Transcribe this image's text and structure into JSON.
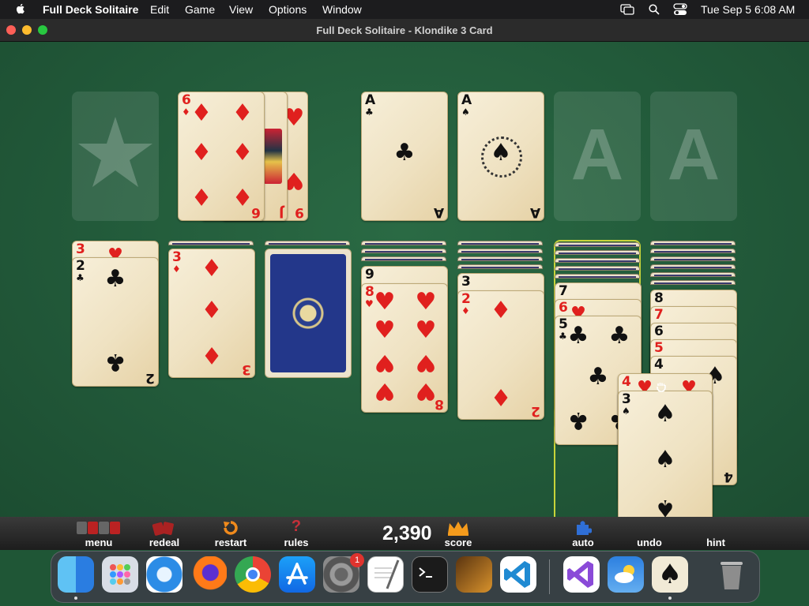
{
  "menubar": {
    "app_name": "Full Deck Solitaire",
    "menus": [
      "Edit",
      "Game",
      "View",
      "Options",
      "Window"
    ],
    "datetime": "Tue Sep 5  6:08 AM"
  },
  "window": {
    "title": "Full Deck Solitaire - Klondike 3 Card"
  },
  "foundation_placeholder_letter": "A",
  "suit_glyphs": {
    "clubs": "♣",
    "spades": "♠",
    "hearts": "♥",
    "diamonds": "♦"
  },
  "cards": {
    "waste_top": {
      "rank": "6",
      "suit": "diamonds"
    },
    "waste_mid": {
      "rank": "J"
    },
    "waste_under": {
      "rank": "9",
      "suit": "hearts"
    },
    "foundation_1": {
      "rank": "A",
      "suit": "clubs"
    },
    "foundation_2": {
      "rank": "A",
      "suit": "spades"
    },
    "t1_under": {
      "rank": "3",
      "suit": "hearts"
    },
    "t1_top": {
      "rank": "2",
      "suit": "clubs"
    },
    "t2_top": {
      "rank": "3",
      "suit": "diamonds"
    },
    "t4_under": {
      "rank": "9",
      "suit": "spades"
    },
    "t4_top": {
      "rank": "8",
      "suit": "hearts"
    },
    "t5_under": {
      "rank": "3",
      "suit": "spades"
    },
    "t5_top": {
      "rank": "2",
      "suit": "diamonds"
    },
    "t6_a": {
      "rank": "7",
      "suit": "clubs"
    },
    "t6_b": {
      "rank": "6",
      "suit": "hearts"
    },
    "t6_top": {
      "rank": "5",
      "suit": "clubs"
    },
    "t7_a": {
      "rank": "8",
      "suit": "spades"
    },
    "t7_b": {
      "rank": "7",
      "suit": "diamonds"
    },
    "t7_c": {
      "rank": "6",
      "suit": "spades"
    },
    "t7_d": {
      "rank": "5",
      "suit": "hearts"
    },
    "t7_top": {
      "rank": "4",
      "suit": "spades"
    },
    "drag_under": {
      "rank": "4",
      "suit": "hearts"
    },
    "drag_top": {
      "rank": "3",
      "suit": "spades"
    }
  },
  "toolbar": {
    "menu": "menu",
    "redeal": "redeal",
    "restart": "restart",
    "rules": "rules",
    "rules_glyph": "?",
    "score_value": "2,390",
    "score_label": "score",
    "auto": "auto",
    "undo": "undo",
    "hint": "hint"
  },
  "dock": {
    "apps": [
      "Finder",
      "Launchpad",
      "Safari",
      "Firefox",
      "Chrome",
      "App Store",
      "System Settings",
      "TextEdit",
      "Terminal",
      "GarageBand",
      "Visual Studio Code",
      "Visual Studio",
      "Weather",
      "Full Deck Solitaire",
      "Trash"
    ],
    "settings_badge": "1"
  },
  "colors": {
    "felt": "#225a3a",
    "red_suit": "#e0201e",
    "black_suit": "#111111",
    "drop_highlight": "#c8d43a"
  }
}
